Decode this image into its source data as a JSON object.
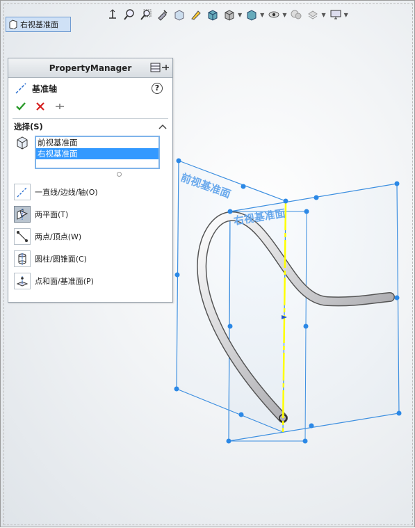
{
  "tab": {
    "label": "右视基准面"
  },
  "toolbar": {
    "icons": [
      "normal-to-icon",
      "zoom-to-fit-icon",
      "zoom-area-icon",
      "previous-view-icon",
      "section-view-icon",
      "dynamic-annotation-icon",
      "view-orientation-icon",
      "display-style-icon",
      "hide-show-icon",
      "edit-appearance-icon",
      "apply-scene-icon",
      "view-settings-icon"
    ]
  },
  "panel": {
    "title": "PropertyManager",
    "feature_title": "基准轴",
    "section_title": "选择(S)",
    "selections": [
      "前视基准面",
      "右视基准面"
    ],
    "options": [
      {
        "label": "一直线/边线/轴(O)"
      },
      {
        "label": "两平面(T)"
      },
      {
        "label": "两点/顶点(W)"
      },
      {
        "label": "圆柱/圆锥面(C)"
      },
      {
        "label": "点和面/基准面(P)"
      }
    ]
  },
  "viewport": {
    "front_plane_label": "前视基准面",
    "right_plane_label": "右视基准面"
  },
  "colors": {
    "plane": "#3d8fe0",
    "plane_label": "#6aa9ec",
    "axis": "#ffff00",
    "selection": "#3399ff"
  }
}
